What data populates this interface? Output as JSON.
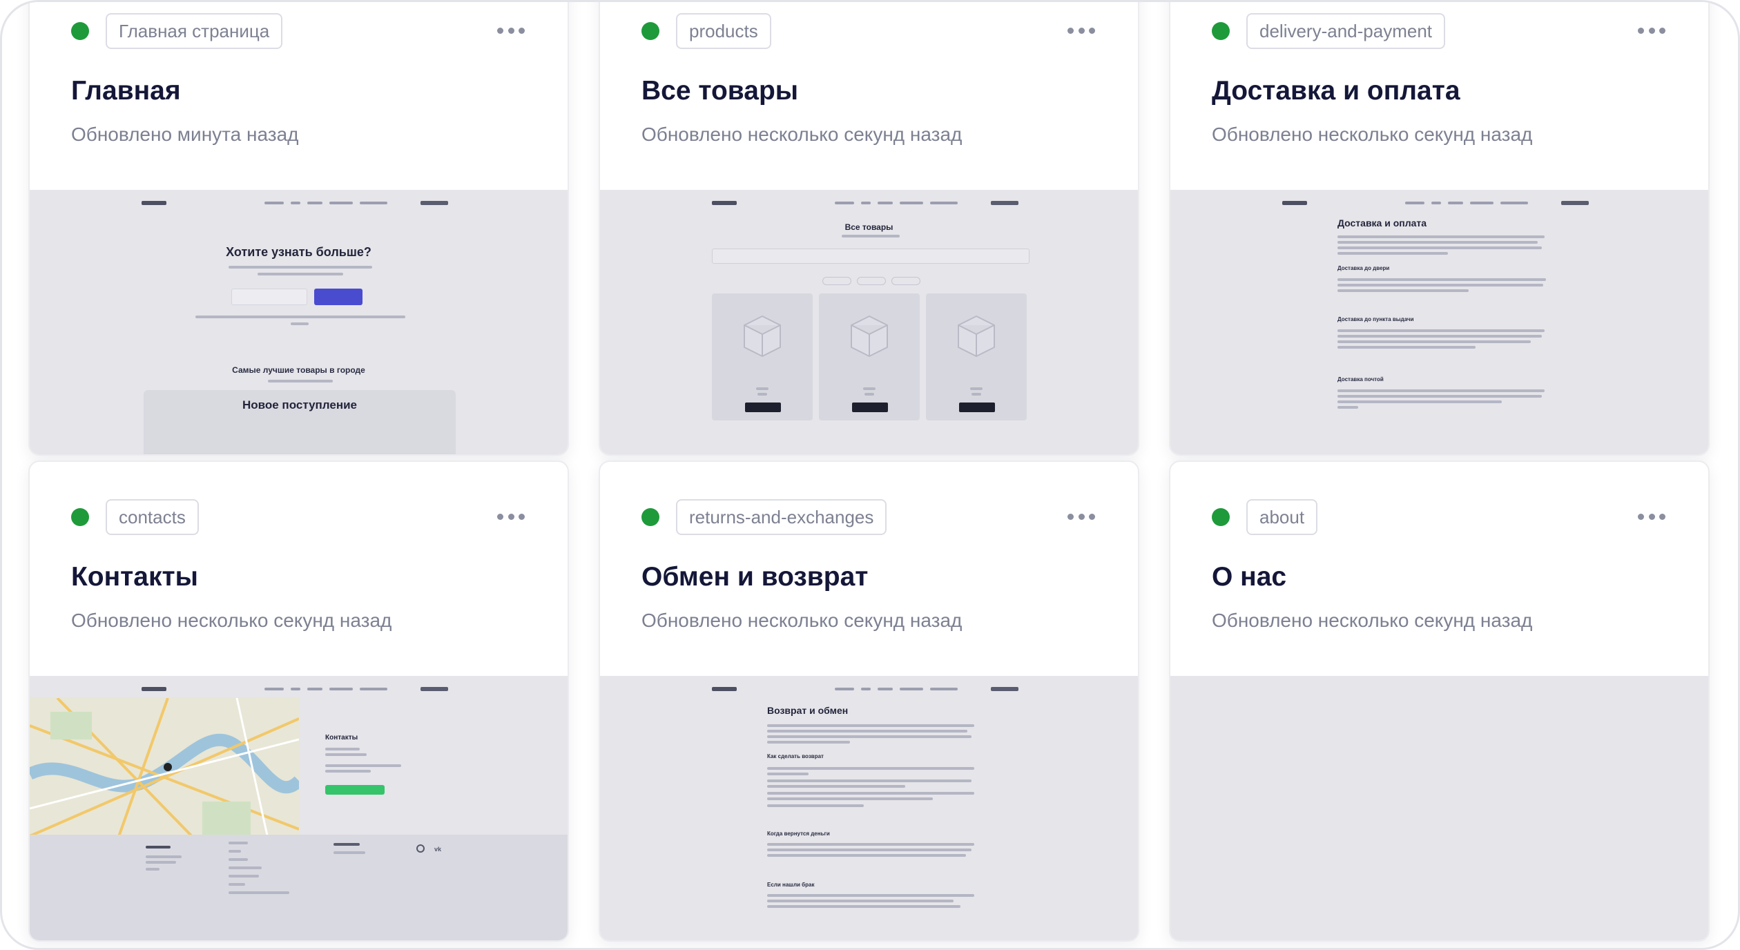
{
  "cards": [
    {
      "slug": "Главная страница",
      "title": "Главная",
      "updated": "Обновлено минута назад"
    },
    {
      "slug": "products",
      "title": "Все товары",
      "updated": "Обновлено несколько секунд назад"
    },
    {
      "slug": "delivery-and-payment",
      "title": "Доставка и оплата",
      "updated": "Обновлено несколько секунд назад"
    },
    {
      "slug": "contacts",
      "title": "Контакты",
      "updated": "Обновлено несколько секунд назад"
    },
    {
      "slug": "returns-and-exchanges",
      "title": "Обмен и возврат",
      "updated": "Обновлено несколько секунд назад"
    },
    {
      "slug": "about",
      "title": "О нас",
      "updated": "Обновлено несколько секунд назад"
    }
  ],
  "previews": {
    "home": {
      "headline": "Хотите узнать больше?",
      "section": "Самые лучшие товары в городе",
      "banner": "Новое поступление"
    },
    "products": {
      "headline": "Все товары"
    },
    "delivery": {
      "headline": "Доставка и оплата",
      "h1": "Доставка до двери",
      "h2": "Доставка до пункта выдачи",
      "h3": "Доставка почтой"
    },
    "contacts": {
      "headline": "Контакты"
    },
    "returns": {
      "headline": "Возврат и обмен",
      "h1": "Как сделать возврат",
      "h2": "Когда вернутся деньги",
      "h3": "Если нашли брак"
    }
  },
  "colors": {
    "status": "#1e9a3b",
    "accent": "#4a4cd0",
    "title": "#141738"
  },
  "icons": {
    "status": "status-dot-icon",
    "more": "more-dots-icon",
    "product": "box-icon"
  }
}
